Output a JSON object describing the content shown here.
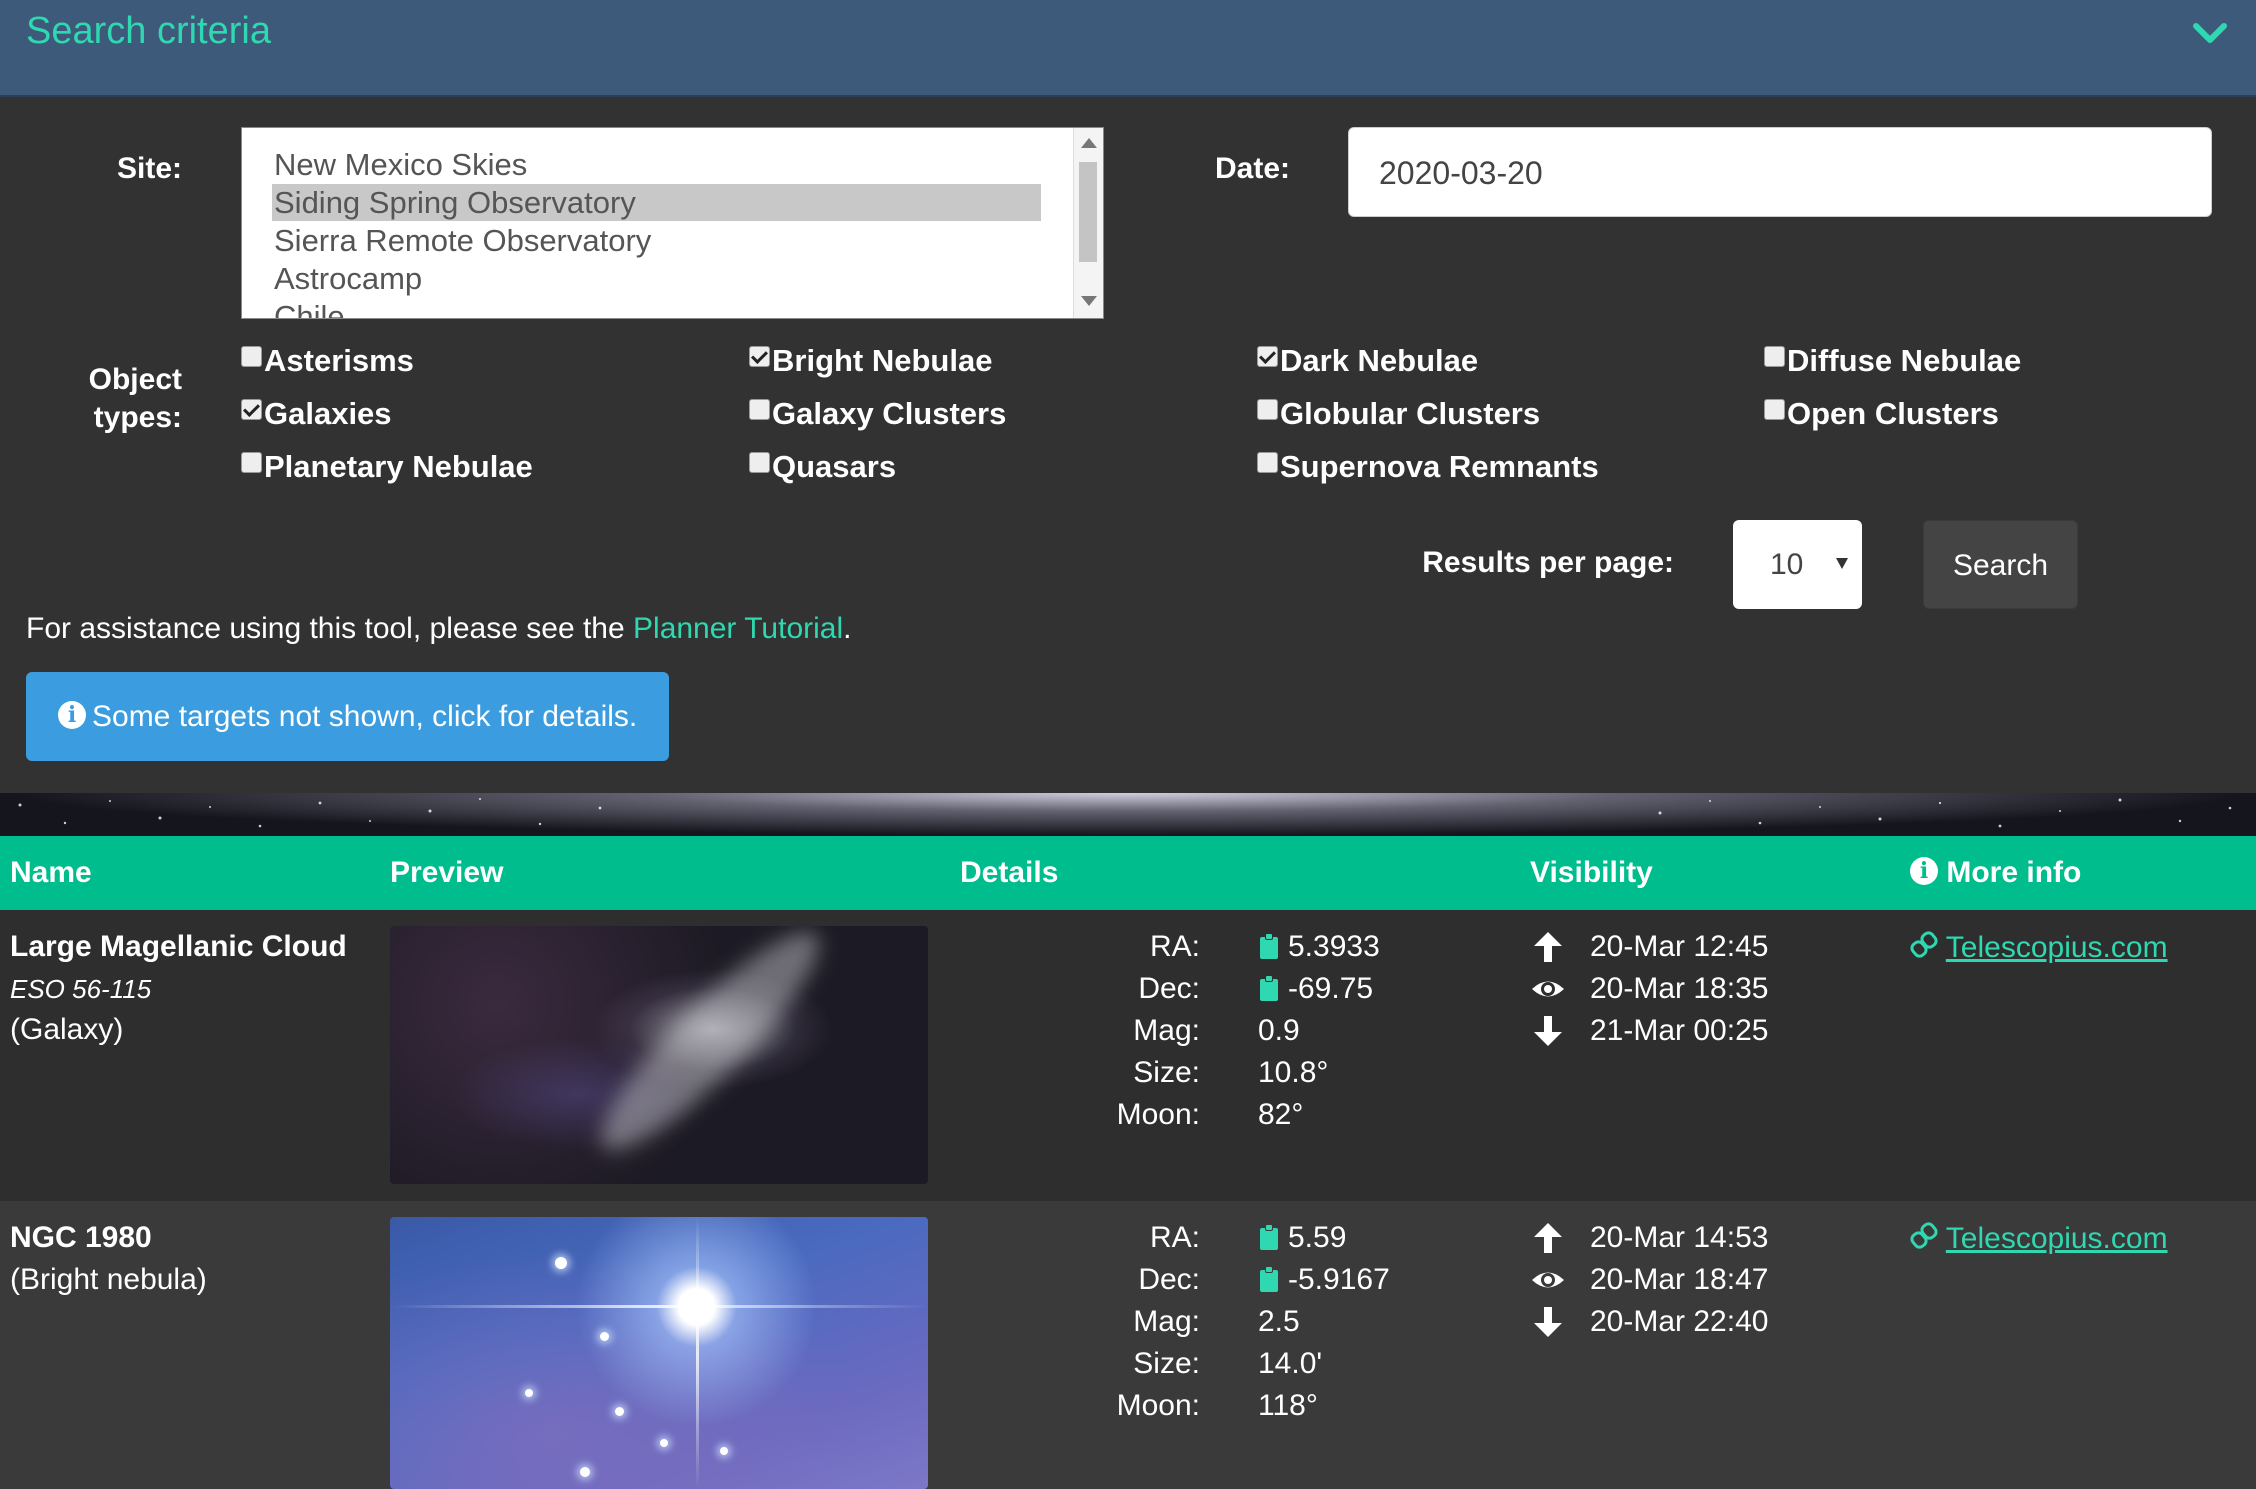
{
  "header": {
    "title": "Search criteria"
  },
  "form": {
    "site_label": "Site:",
    "site_options": [
      "New Mexico Skies",
      "Siding Spring Observatory",
      "Sierra Remote Observatory",
      "Astrocamp",
      "Chile"
    ],
    "site_selected": "Siding Spring Observatory",
    "date_label": "Date:",
    "date_value": "2020-03-20",
    "object_types_label_1": "Object",
    "object_types_label_2": "types:",
    "object_types": [
      {
        "label": "Asterisms",
        "checked": false
      },
      {
        "label": "Bright Nebulae",
        "checked": true
      },
      {
        "label": "Dark Nebulae",
        "checked": true
      },
      {
        "label": "Diffuse Nebulae",
        "checked": false
      },
      {
        "label": "Galaxies",
        "checked": true
      },
      {
        "label": "Galaxy Clusters",
        "checked": false
      },
      {
        "label": "Globular Clusters",
        "checked": false
      },
      {
        "label": "Open Clusters",
        "checked": false
      },
      {
        "label": "Planetary Nebulae",
        "checked": false
      },
      {
        "label": "Quasars",
        "checked": false
      },
      {
        "label": "Supernova Remnants",
        "checked": false
      }
    ],
    "results_per_page_label": "Results per page:",
    "results_per_page_value": "10",
    "search_button": "Search"
  },
  "assist": {
    "text": "For assistance using this tool, please see the ",
    "link": "Planner Tutorial",
    "suffix": "."
  },
  "notice": {
    "text": "Some targets not shown, click for details."
  },
  "table": {
    "headers": {
      "name": "Name",
      "preview": "Preview",
      "details": "Details",
      "visibility": "Visibility",
      "more_info": "More info"
    },
    "detail_labels": {
      "ra": "RA:",
      "dec": "Dec:",
      "mag": "Mag:",
      "size": "Size:",
      "moon": "Moon:"
    },
    "rows": [
      {
        "name": "Large Magellanic Cloud",
        "alt": "ESO 56-115",
        "type": "(Galaxy)",
        "ra": "5.3933",
        "dec": "-69.75",
        "mag": "0.9",
        "size": "10.8°",
        "moon": "82°",
        "rise": "20-Mar 12:45",
        "transit": "20-Mar 18:35",
        "set": "21-Mar 00:25",
        "link": "Telescopius.com"
      },
      {
        "name": "NGC 1980",
        "type": "(Bright nebula)",
        "ra": "5.59",
        "dec": "-5.9167",
        "mag": "2.5",
        "size": "14.0'",
        "moon": "118°",
        "rise": "20-Mar 14:53",
        "transit": "20-Mar 18:47",
        "set": "20-Mar 22:40",
        "link": "Telescopius.com"
      }
    ]
  },
  "colors": {
    "accent": "#2fd8b0",
    "header_bg": "#3d5a7a",
    "table_header_bg": "#00bd8d",
    "notice_bg": "#3b9ddf"
  }
}
